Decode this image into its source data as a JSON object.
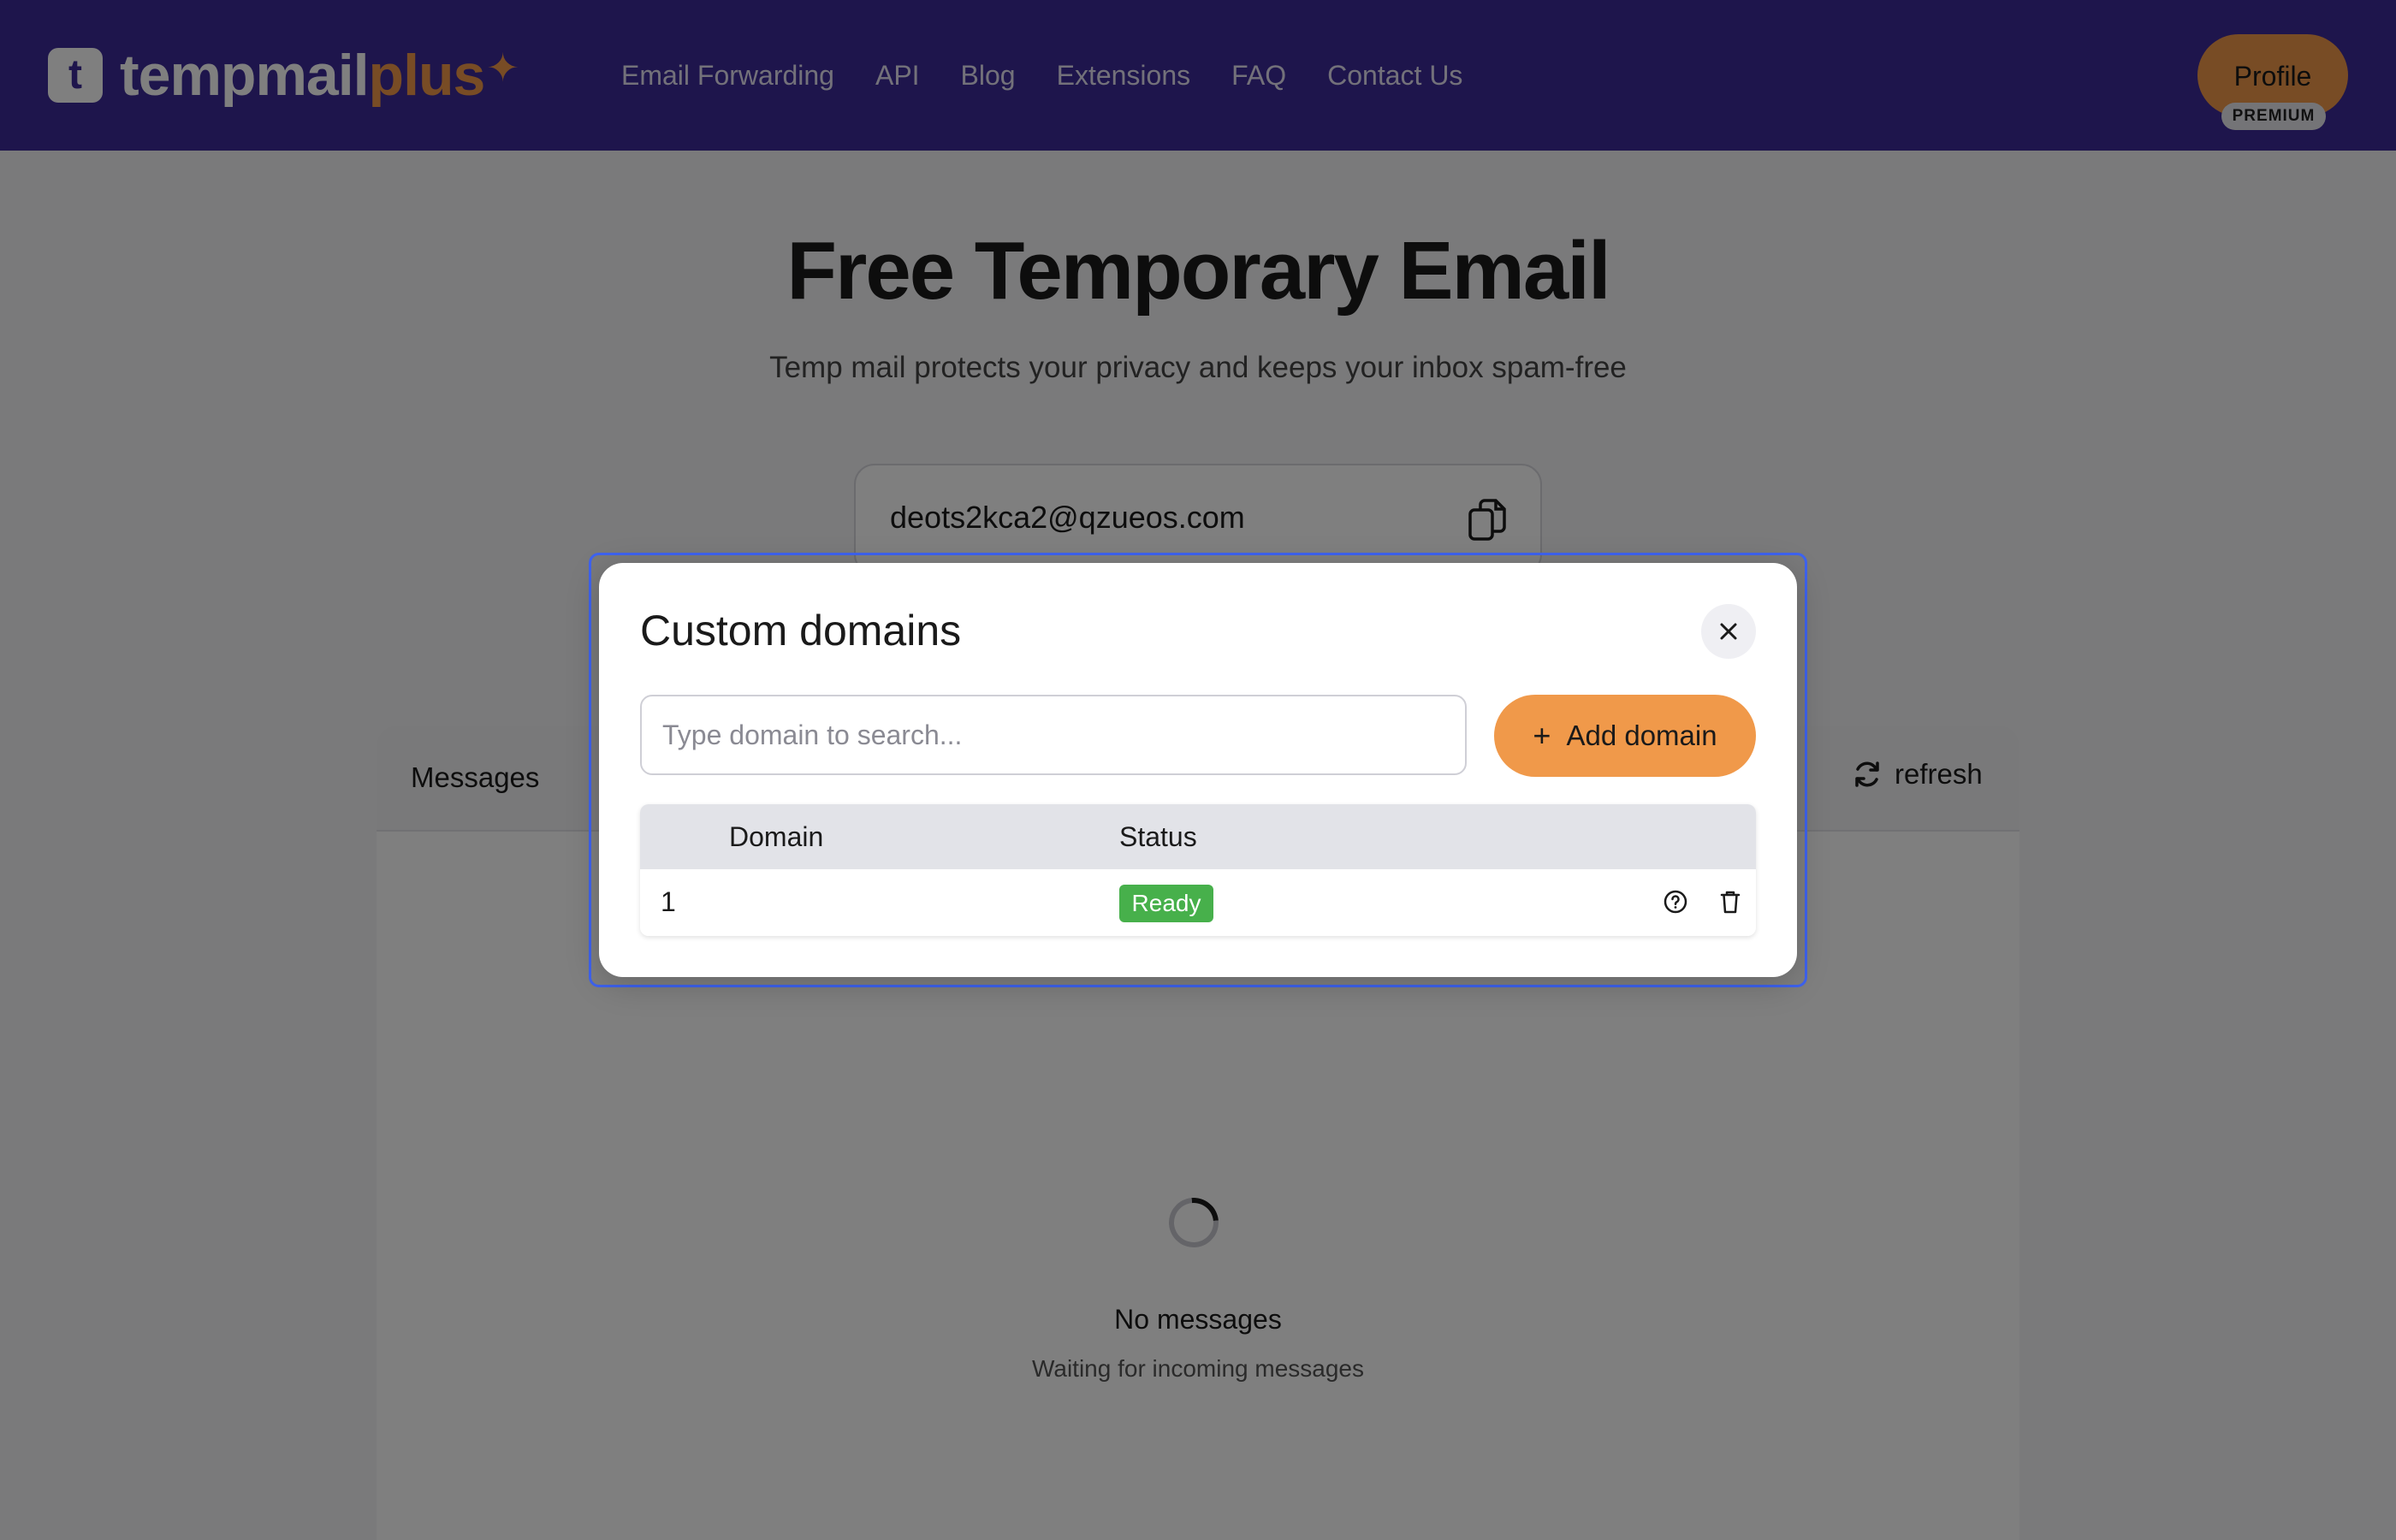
{
  "header": {
    "logo_letter": "t",
    "logo_text_primary": "tempmail",
    "logo_text_accent": "plus",
    "nav": [
      "Email Forwarding",
      "API",
      "Blog",
      "Extensions",
      "FAQ",
      "Contact Us"
    ],
    "profile_label": "Profile",
    "premium_label": "PREMIUM"
  },
  "hero": {
    "title": "Free Temporary Email",
    "subtitle": "Temp mail protects your privacy and keeps your inbox spam-free"
  },
  "email": {
    "address": "deots2kca2@qzueos.com"
  },
  "inbox": {
    "title": "Messages",
    "refresh_label": "refresh",
    "empty_title": "No messages",
    "empty_subtitle": "Waiting for incoming messages"
  },
  "modal": {
    "title": "Custom domains",
    "search_placeholder": "Type domain to search...",
    "add_button_label": "Add domain",
    "columns": [
      "Domain",
      "Status"
    ],
    "rows": [
      {
        "index": "1",
        "domain": "",
        "status": "Ready"
      }
    ]
  },
  "colors": {
    "header_bg": "#3d2a99",
    "accent": "#f0994a",
    "status_ready": "#47b04b",
    "focus_ring": "#3e63f0"
  },
  "icons": [
    "copy-icon",
    "refresh-icon",
    "close-icon",
    "plus-icon",
    "help-circle-icon",
    "trash-icon"
  ]
}
